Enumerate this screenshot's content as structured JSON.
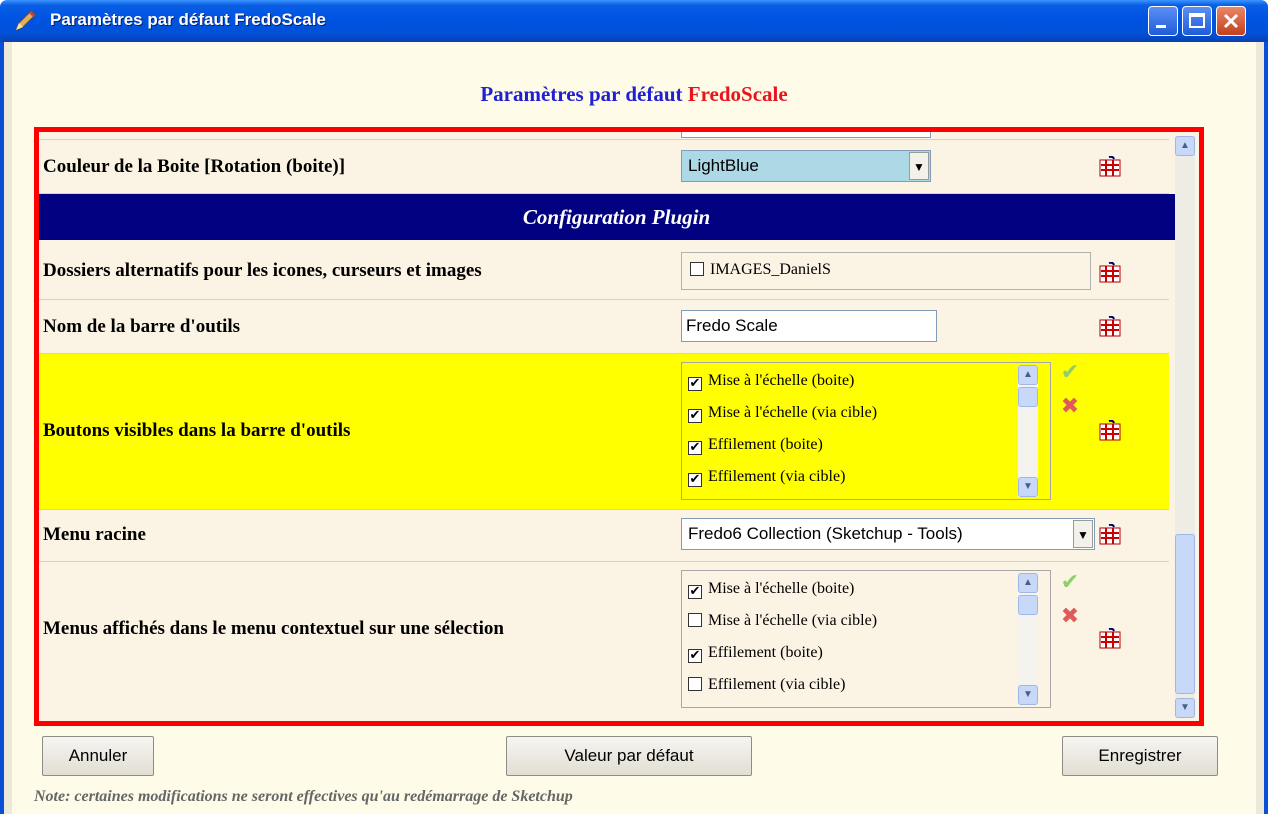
{
  "window": {
    "title": "Paramètres par défaut FredoScale",
    "icon": "pencil-icon",
    "minimize_icon": "minimize-icon",
    "maximize_icon": "maximize-icon",
    "close_icon": "close-icon"
  },
  "heading": {
    "prefix": "Paramètres par défaut",
    "brand": "FredoScale"
  },
  "rows": {
    "box_color": {
      "label": "Couleur de la Boite [Rotation (boite)]",
      "value": "LightBlue"
    },
    "section": {
      "label": "Configuration Plugin"
    },
    "alt_folders": {
      "label": "Dossiers alternatifs pour les icones, curseurs et images",
      "option": "IMAGES_DanielS",
      "checked": false
    },
    "toolbar_name": {
      "label": "Nom de la barre d'outils",
      "value": "Fredo Scale"
    },
    "toolbar_buttons": {
      "label": "Boutons visibles dans la barre d'outils",
      "items": [
        {
          "label": "Mise à l'échelle (boite)",
          "checked": true
        },
        {
          "label": "Mise à l'échelle (via cible)",
          "checked": true
        },
        {
          "label": "Effilement (boite)",
          "checked": true
        },
        {
          "label": "Effilement (via cible)",
          "checked": true
        }
      ]
    },
    "root_menu": {
      "label": "Menu racine",
      "value": "Fredo6 Collection (Sketchup - Tools)"
    },
    "context_menus": {
      "label": "Menus affichés dans le menu contextuel sur une sélection",
      "items": [
        {
          "label": "Mise à l'échelle (boite)",
          "checked": true
        },
        {
          "label": "Mise à l'échelle (via cible)",
          "checked": false
        },
        {
          "label": "Effilement (boite)",
          "checked": true
        },
        {
          "label": "Effilement (via cible)",
          "checked": false
        }
      ]
    }
  },
  "buttons": {
    "cancel": "Annuler",
    "default": "Valeur par défaut",
    "save": "Enregistrer"
  },
  "note": "Note: certaines modifications ne seront effectives qu'au redémarrage de Sketchup",
  "colors": {
    "title_bar": "#0054e3",
    "heading": "#2020d0",
    "brand": "#e8141c",
    "section": "#000080",
    "highlight": "#ffff00",
    "frame": "#ff0000",
    "combo_bg": "#add8e6"
  }
}
